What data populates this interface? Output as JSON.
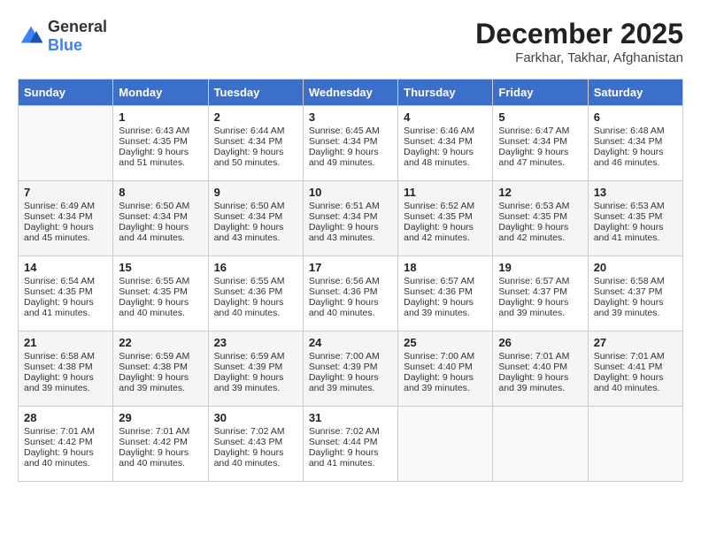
{
  "header": {
    "logo": {
      "text1": "General",
      "text2": "Blue"
    },
    "month": "December 2025",
    "location": "Farkhar, Takhar, Afghanistan"
  },
  "days_of_week": [
    "Sunday",
    "Monday",
    "Tuesday",
    "Wednesday",
    "Thursday",
    "Friday",
    "Saturday"
  ],
  "weeks": [
    [
      {
        "day": "",
        "sunrise": "",
        "sunset": "",
        "daylight": ""
      },
      {
        "day": "1",
        "sunrise": "Sunrise: 6:43 AM",
        "sunset": "Sunset: 4:35 PM",
        "daylight": "Daylight: 9 hours and 51 minutes."
      },
      {
        "day": "2",
        "sunrise": "Sunrise: 6:44 AM",
        "sunset": "Sunset: 4:34 PM",
        "daylight": "Daylight: 9 hours and 50 minutes."
      },
      {
        "day": "3",
        "sunrise": "Sunrise: 6:45 AM",
        "sunset": "Sunset: 4:34 PM",
        "daylight": "Daylight: 9 hours and 49 minutes."
      },
      {
        "day": "4",
        "sunrise": "Sunrise: 6:46 AM",
        "sunset": "Sunset: 4:34 PM",
        "daylight": "Daylight: 9 hours and 48 minutes."
      },
      {
        "day": "5",
        "sunrise": "Sunrise: 6:47 AM",
        "sunset": "Sunset: 4:34 PM",
        "daylight": "Daylight: 9 hours and 47 minutes."
      },
      {
        "day": "6",
        "sunrise": "Sunrise: 6:48 AM",
        "sunset": "Sunset: 4:34 PM",
        "daylight": "Daylight: 9 hours and 46 minutes."
      }
    ],
    [
      {
        "day": "7",
        "sunrise": "Sunrise: 6:49 AM",
        "sunset": "Sunset: 4:34 PM",
        "daylight": "Daylight: 9 hours and 45 minutes."
      },
      {
        "day": "8",
        "sunrise": "Sunrise: 6:50 AM",
        "sunset": "Sunset: 4:34 PM",
        "daylight": "Daylight: 9 hours and 44 minutes."
      },
      {
        "day": "9",
        "sunrise": "Sunrise: 6:50 AM",
        "sunset": "Sunset: 4:34 PM",
        "daylight": "Daylight: 9 hours and 43 minutes."
      },
      {
        "day": "10",
        "sunrise": "Sunrise: 6:51 AM",
        "sunset": "Sunset: 4:34 PM",
        "daylight": "Daylight: 9 hours and 43 minutes."
      },
      {
        "day": "11",
        "sunrise": "Sunrise: 6:52 AM",
        "sunset": "Sunset: 4:35 PM",
        "daylight": "Daylight: 9 hours and 42 minutes."
      },
      {
        "day": "12",
        "sunrise": "Sunrise: 6:53 AM",
        "sunset": "Sunset: 4:35 PM",
        "daylight": "Daylight: 9 hours and 42 minutes."
      },
      {
        "day": "13",
        "sunrise": "Sunrise: 6:53 AM",
        "sunset": "Sunset: 4:35 PM",
        "daylight": "Daylight: 9 hours and 41 minutes."
      }
    ],
    [
      {
        "day": "14",
        "sunrise": "Sunrise: 6:54 AM",
        "sunset": "Sunset: 4:35 PM",
        "daylight": "Daylight: 9 hours and 41 minutes."
      },
      {
        "day": "15",
        "sunrise": "Sunrise: 6:55 AM",
        "sunset": "Sunset: 4:35 PM",
        "daylight": "Daylight: 9 hours and 40 minutes."
      },
      {
        "day": "16",
        "sunrise": "Sunrise: 6:55 AM",
        "sunset": "Sunset: 4:36 PM",
        "daylight": "Daylight: 9 hours and 40 minutes."
      },
      {
        "day": "17",
        "sunrise": "Sunrise: 6:56 AM",
        "sunset": "Sunset: 4:36 PM",
        "daylight": "Daylight: 9 hours and 40 minutes."
      },
      {
        "day": "18",
        "sunrise": "Sunrise: 6:57 AM",
        "sunset": "Sunset: 4:36 PM",
        "daylight": "Daylight: 9 hours and 39 minutes."
      },
      {
        "day": "19",
        "sunrise": "Sunrise: 6:57 AM",
        "sunset": "Sunset: 4:37 PM",
        "daylight": "Daylight: 9 hours and 39 minutes."
      },
      {
        "day": "20",
        "sunrise": "Sunrise: 6:58 AM",
        "sunset": "Sunset: 4:37 PM",
        "daylight": "Daylight: 9 hours and 39 minutes."
      }
    ],
    [
      {
        "day": "21",
        "sunrise": "Sunrise: 6:58 AM",
        "sunset": "Sunset: 4:38 PM",
        "daylight": "Daylight: 9 hours and 39 minutes."
      },
      {
        "day": "22",
        "sunrise": "Sunrise: 6:59 AM",
        "sunset": "Sunset: 4:38 PM",
        "daylight": "Daylight: 9 hours and 39 minutes."
      },
      {
        "day": "23",
        "sunrise": "Sunrise: 6:59 AM",
        "sunset": "Sunset: 4:39 PM",
        "daylight": "Daylight: 9 hours and 39 minutes."
      },
      {
        "day": "24",
        "sunrise": "Sunrise: 7:00 AM",
        "sunset": "Sunset: 4:39 PM",
        "daylight": "Daylight: 9 hours and 39 minutes."
      },
      {
        "day": "25",
        "sunrise": "Sunrise: 7:00 AM",
        "sunset": "Sunset: 4:40 PM",
        "daylight": "Daylight: 9 hours and 39 minutes."
      },
      {
        "day": "26",
        "sunrise": "Sunrise: 7:01 AM",
        "sunset": "Sunset: 4:40 PM",
        "daylight": "Daylight: 9 hours and 39 minutes."
      },
      {
        "day": "27",
        "sunrise": "Sunrise: 7:01 AM",
        "sunset": "Sunset: 4:41 PM",
        "daylight": "Daylight: 9 hours and 40 minutes."
      }
    ],
    [
      {
        "day": "28",
        "sunrise": "Sunrise: 7:01 AM",
        "sunset": "Sunset: 4:42 PM",
        "daylight": "Daylight: 9 hours and 40 minutes."
      },
      {
        "day": "29",
        "sunrise": "Sunrise: 7:01 AM",
        "sunset": "Sunset: 4:42 PM",
        "daylight": "Daylight: 9 hours and 40 minutes."
      },
      {
        "day": "30",
        "sunrise": "Sunrise: 7:02 AM",
        "sunset": "Sunset: 4:43 PM",
        "daylight": "Daylight: 9 hours and 40 minutes."
      },
      {
        "day": "31",
        "sunrise": "Sunrise: 7:02 AM",
        "sunset": "Sunset: 4:44 PM",
        "daylight": "Daylight: 9 hours and 41 minutes."
      },
      {
        "day": "",
        "sunrise": "",
        "sunset": "",
        "daylight": ""
      },
      {
        "day": "",
        "sunrise": "",
        "sunset": "",
        "daylight": ""
      },
      {
        "day": "",
        "sunrise": "",
        "sunset": "",
        "daylight": ""
      }
    ]
  ]
}
